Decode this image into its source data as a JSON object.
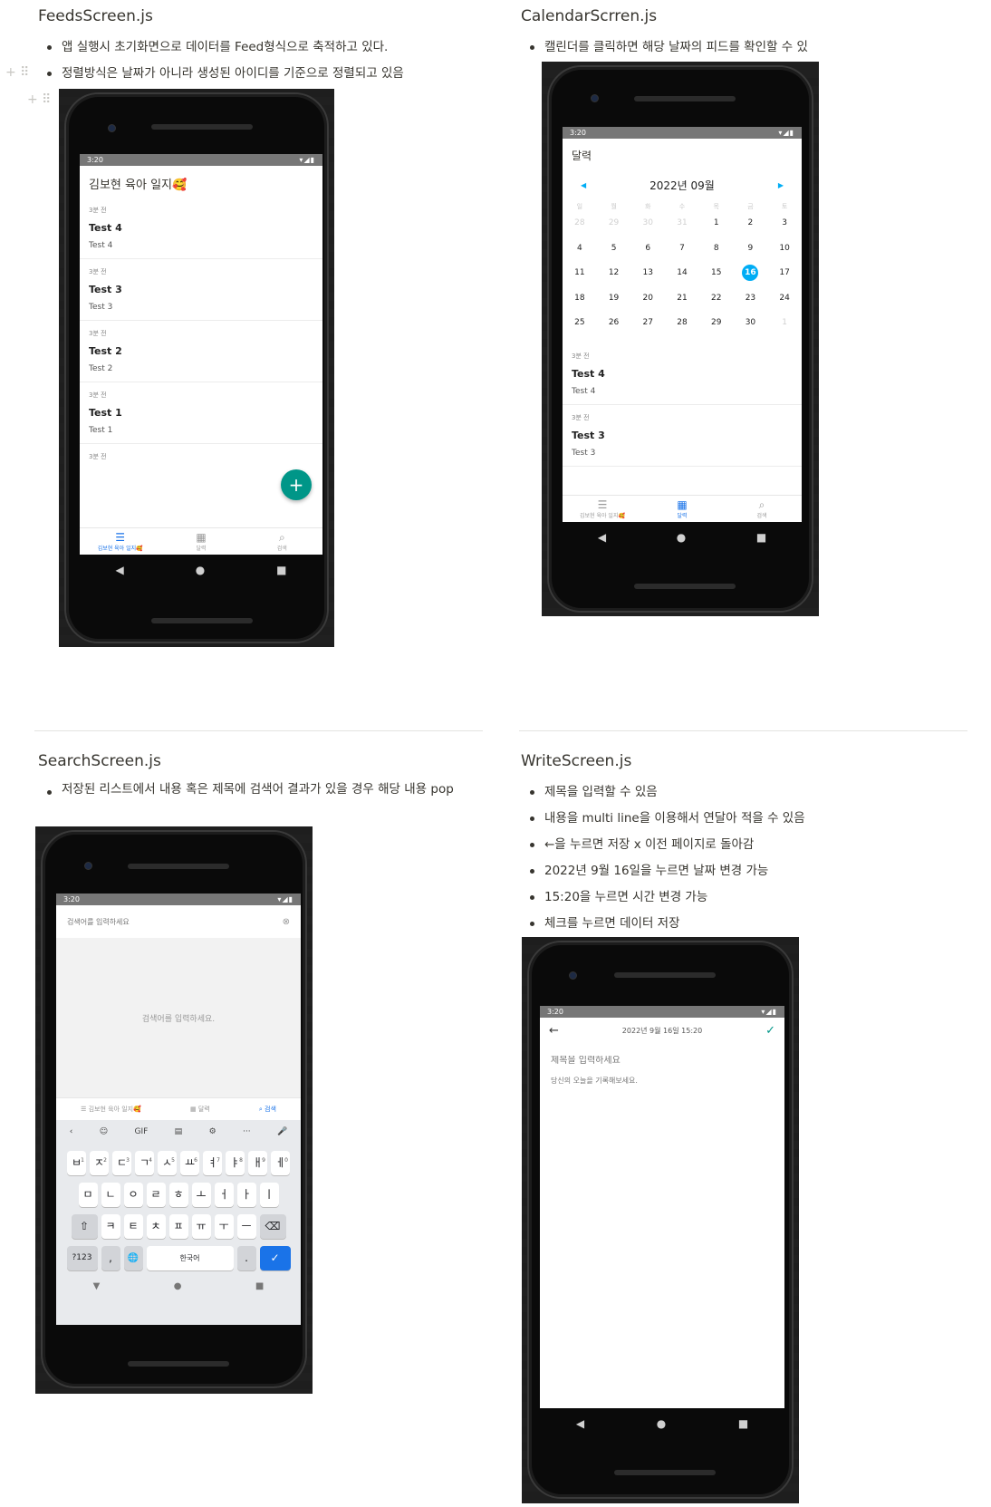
{
  "sections": {
    "feeds": {
      "title": "FeedsScreen.js",
      "bullets": [
        "앱 실행시 초기화면으로 데이터를 Feed형식으로 축적하고 있다.",
        "정렬방식은 날짜가 아니라 생성된 아이디를 기준으로 정렬되고 있음"
      ]
    },
    "calendar": {
      "title": "CalendarScrren.js",
      "bullets": [
        "캘린더를 클릭하면 해당 날짜의 피드를 확인할 수 있"
      ]
    },
    "search": {
      "title": "SearchScreen.js",
      "bullets": [
        "저장된 리스트에서 내용 혹은 제목에 검색어 결과가 있을 경우 해당 내용 pop"
      ]
    },
    "write": {
      "title": "WriteScreen.js",
      "bullets": [
        "제목을 입력할 수 있음",
        "내용을 multi line을 이용해서 연달아 적을 수 있음",
        "←을 누르면 저장 x 이전 페이지로 돌아감",
        "2022년 9월 16일을 누르면 날짜 변경 가능",
        "15:20을 누르면 시간 변경 가능",
        "체크를 누르면 데이터 저장"
      ]
    }
  },
  "status": {
    "time": "3:20",
    "icons": "▾◢▮"
  },
  "feeds_app": {
    "header": "김보현 육아 일지🥰",
    "items": [
      {
        "time": "3분 전",
        "title": "Test 4",
        "body": "Test 4"
      },
      {
        "time": "3분 전",
        "title": "Test 3",
        "body": "Test 3"
      },
      {
        "time": "3분 전",
        "title": "Test 2",
        "body": "Test 2"
      },
      {
        "time": "3분 전",
        "title": "Test 1",
        "body": "Test 1"
      },
      {
        "time": "3분 전",
        "title": "",
        "body": ""
      }
    ],
    "fab": "+",
    "tabs": [
      {
        "label": "김보현 육아 일지🥰",
        "icon": "☰"
      },
      {
        "label": "달력",
        "icon": "▦"
      },
      {
        "label": "검색",
        "icon": "⌕"
      }
    ]
  },
  "calendar_app": {
    "header": "달력",
    "month": "2022년 09월",
    "weekdays": [
      "일",
      "월",
      "화",
      "수",
      "목",
      "금",
      "토"
    ],
    "days": [
      [
        "28",
        "29",
        "30",
        "31",
        "1",
        "2",
        "3"
      ],
      [
        "4",
        "5",
        "6",
        "7",
        "8",
        "9",
        "10"
      ],
      [
        "11",
        "12",
        "13",
        "14",
        "15",
        "16",
        "17"
      ],
      [
        "18",
        "19",
        "20",
        "21",
        "22",
        "23",
        "24"
      ],
      [
        "25",
        "26",
        "27",
        "28",
        "29",
        "30",
        "1"
      ]
    ],
    "selected_day": "16",
    "items": [
      {
        "time": "3분 전",
        "title": "Test 4",
        "body": "Test 4"
      },
      {
        "time": "3분 전",
        "title": "Test 3",
        "body": "Test 3"
      }
    ],
    "tabs": [
      {
        "label": "김보현 육아 일지🥰",
        "icon": "☰"
      },
      {
        "label": "달력",
        "icon": "▦"
      },
      {
        "label": "검색",
        "icon": "⌕"
      }
    ]
  },
  "search_app": {
    "placeholder": "검색어를 입력하세요",
    "empty": "검색어를 입력하세요.",
    "tabs": [
      {
        "label": "김보현 육아 일지🥰",
        "icon": "☰"
      },
      {
        "label": "달력",
        "icon": "▦"
      },
      {
        "label": "검색",
        "icon": "⌕"
      }
    ],
    "kb_tools": [
      "‹",
      "☺",
      "GIF",
      "▤",
      "⚙",
      "···",
      "🎤"
    ],
    "kb_row1": [
      [
        "ㅂ",
        "1"
      ],
      [
        "ㅈ",
        "2"
      ],
      [
        "ㄷ",
        "3"
      ],
      [
        "ㄱ",
        "4"
      ],
      [
        "ㅅ",
        "5"
      ],
      [
        "ㅛ",
        "6"
      ],
      [
        "ㅕ",
        "7"
      ],
      [
        "ㅑ",
        "8"
      ],
      [
        "ㅐ",
        "9"
      ],
      [
        "ㅔ",
        "0"
      ]
    ],
    "kb_row2": [
      "ㅁ",
      "ㄴ",
      "ㅇ",
      "ㄹ",
      "ㅎ",
      "ㅗ",
      "ㅓ",
      "ㅏ",
      "ㅣ"
    ],
    "kb_row3": [
      "⇧",
      "ㅋ",
      "ㅌ",
      "ㅊ",
      "ㅍ",
      "ㅠ",
      "ㅜ",
      "ㅡ",
      "⌫"
    ],
    "kb_row4": {
      "sym": "?123",
      "comma": ",",
      "globe": "🌐",
      "space": "한국어",
      "period": ".",
      "enter": "✓"
    }
  },
  "write_app": {
    "date": "2022년 9월 16일",
    "time": "15:20",
    "back": "←",
    "check": "✓",
    "title_placeholder": "제목을 입력하세요",
    "body_placeholder": "당신의 오늘을 기록해보세요."
  },
  "nav": {
    "back": "◀",
    "home": "●",
    "recent": "■"
  },
  "colors": {
    "teal": "#009688",
    "blue": "#1a73e8",
    "cal_blue": "#00adf5",
    "status": "#777777"
  }
}
